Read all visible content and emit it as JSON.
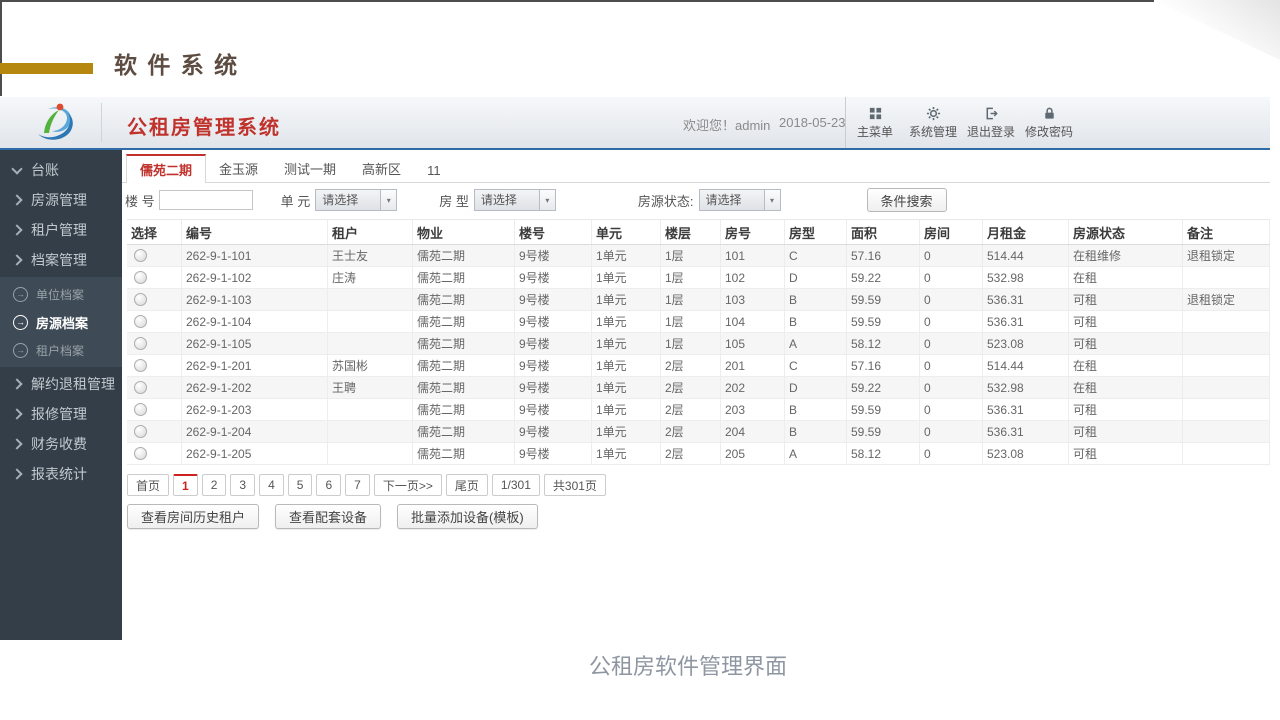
{
  "page": {
    "slide_title": "软 件 系 统",
    "caption": "公租房软件管理界面"
  },
  "colors": {
    "accent_red": "#c1322c",
    "header_blue": "#2f6ba6",
    "gold": "#b5870e",
    "sidebar_bg": "#333e48"
  },
  "header": {
    "app_title": "公租房管理系统",
    "welcome": "欢迎您！admin",
    "date": "2018-05-23",
    "menu": [
      {
        "name": "main-menu",
        "label": "主菜单",
        "icon": "grid-icon"
      },
      {
        "name": "system-management",
        "label": "系统管理",
        "icon": "gear-icon"
      },
      {
        "name": "logout",
        "label": "退出登录",
        "icon": "logout-icon"
      },
      {
        "name": "change-password",
        "label": "修改密码",
        "icon": "lock-icon"
      }
    ]
  },
  "sidebar": {
    "items": [
      {
        "name": "ledger",
        "label": "台账",
        "type": "group",
        "chevron": "down"
      },
      {
        "name": "housing-management",
        "label": "房源管理",
        "type": "group",
        "chevron": "right"
      },
      {
        "name": "tenant-management",
        "label": "租户管理",
        "type": "group",
        "chevron": "right"
      },
      {
        "name": "archive-management",
        "label": "档案管理",
        "type": "group",
        "chevron": "right"
      },
      {
        "name": "unit-archive",
        "label": "单位档案",
        "type": "sub",
        "active": false
      },
      {
        "name": "housing-archive",
        "label": "房源档案",
        "type": "sub",
        "active": true
      },
      {
        "name": "tenant-archive",
        "label": "租户档案",
        "type": "sub",
        "active": false
      },
      {
        "name": "termination-management",
        "label": "解约退租管理",
        "type": "group",
        "chevron": "right"
      },
      {
        "name": "repair-management",
        "label": "报修管理",
        "type": "group",
        "chevron": "right"
      },
      {
        "name": "finance-charges",
        "label": "财务收费",
        "type": "group",
        "chevron": "right"
      },
      {
        "name": "report-statistics",
        "label": "报表统计",
        "type": "group",
        "chevron": "right"
      }
    ]
  },
  "tabs": {
    "active_index": 0,
    "items": [
      {
        "name": "ruyuan-phase2",
        "label": "儒苑二期"
      },
      {
        "name": "jinyuyuan",
        "label": "金玉源"
      },
      {
        "name": "test-phase1",
        "label": "测试一期"
      },
      {
        "name": "gaoxin-district",
        "label": "高新区"
      },
      {
        "name": "11",
        "label": "11"
      }
    ]
  },
  "search": {
    "building": {
      "label": "楼 号",
      "value": ""
    },
    "unit": {
      "label": "单 元",
      "value": "请选择"
    },
    "room_type": {
      "label": "房 型",
      "value": "请选择"
    },
    "status": {
      "label": "房源状态:",
      "value": "请选择"
    },
    "submit_label": "条件搜索"
  },
  "table": {
    "columns": [
      {
        "name": "select",
        "label": "选择"
      },
      {
        "name": "code",
        "label": "编号"
      },
      {
        "name": "tenant",
        "label": "租户"
      },
      {
        "name": "property",
        "label": "物业"
      },
      {
        "name": "building",
        "label": "楼号"
      },
      {
        "name": "unit",
        "label": "单元"
      },
      {
        "name": "floor",
        "label": "楼层"
      },
      {
        "name": "room",
        "label": "房号"
      },
      {
        "name": "room-type",
        "label": "房型"
      },
      {
        "name": "area",
        "label": "面积"
      },
      {
        "name": "rooms",
        "label": "房间"
      },
      {
        "name": "rent",
        "label": "月租金"
      },
      {
        "name": "status",
        "label": "房源状态"
      },
      {
        "name": "note",
        "label": "备注"
      }
    ],
    "rows": [
      [
        "262-9-1-101",
        "王士友",
        "儒苑二期",
        "9号楼",
        "1单元",
        "1层",
        "101",
        "C",
        "57.16",
        "0",
        "514.44",
        "在租维修",
        "退租锁定"
      ],
      [
        "262-9-1-102",
        "庄涛",
        "儒苑二期",
        "9号楼",
        "1单元",
        "1层",
        "102",
        "D",
        "59.22",
        "0",
        "532.98",
        "在租",
        ""
      ],
      [
        "262-9-1-103",
        "",
        "儒苑二期",
        "9号楼",
        "1单元",
        "1层",
        "103",
        "B",
        "59.59",
        "0",
        "536.31",
        "可租",
        "退租锁定"
      ],
      [
        "262-9-1-104",
        "",
        "儒苑二期",
        "9号楼",
        "1单元",
        "1层",
        "104",
        "B",
        "59.59",
        "0",
        "536.31",
        "可租",
        ""
      ],
      [
        "262-9-1-105",
        "",
        "儒苑二期",
        "9号楼",
        "1单元",
        "1层",
        "105",
        "A",
        "58.12",
        "0",
        "523.08",
        "可租",
        ""
      ],
      [
        "262-9-1-201",
        "苏国彬",
        "儒苑二期",
        "9号楼",
        "1单元",
        "2层",
        "201",
        "C",
        "57.16",
        "0",
        "514.44",
        "在租",
        ""
      ],
      [
        "262-9-1-202",
        "王聘",
        "儒苑二期",
        "9号楼",
        "1单元",
        "2层",
        "202",
        "D",
        "59.22",
        "0",
        "532.98",
        "在租",
        ""
      ],
      [
        "262-9-1-203",
        "",
        "儒苑二期",
        "9号楼",
        "1单元",
        "2层",
        "203",
        "B",
        "59.59",
        "0",
        "536.31",
        "可租",
        ""
      ],
      [
        "262-9-1-204",
        "",
        "儒苑二期",
        "9号楼",
        "1单元",
        "2层",
        "204",
        "B",
        "59.59",
        "0",
        "536.31",
        "可租",
        ""
      ],
      [
        "262-9-1-205",
        "",
        "儒苑二期",
        "9号楼",
        "1单元",
        "2层",
        "205",
        "A",
        "58.12",
        "0",
        "523.08",
        "可租",
        ""
      ]
    ]
  },
  "pagination": {
    "items": [
      {
        "name": "first",
        "label": "首页"
      },
      {
        "name": "page-1",
        "label": "1",
        "active": true
      },
      {
        "name": "page-2",
        "label": "2"
      },
      {
        "name": "page-3",
        "label": "3"
      },
      {
        "name": "page-4",
        "label": "4"
      },
      {
        "name": "page-5",
        "label": "5"
      },
      {
        "name": "page-6",
        "label": "6"
      },
      {
        "name": "page-7",
        "label": "7"
      },
      {
        "name": "next",
        "label": "下一页>>"
      },
      {
        "name": "last",
        "label": "尾页"
      },
      {
        "name": "current-indicator",
        "label": "1/301"
      },
      {
        "name": "total-pages",
        "label": "共301页"
      }
    ]
  },
  "actions": [
    {
      "name": "view-room-history-tenants",
      "label": "查看房间历史租户"
    },
    {
      "name": "view-equipment",
      "label": "查看配套设备"
    },
    {
      "name": "batch-add-equipment-template",
      "label": "批量添加设备(模板)"
    }
  ]
}
